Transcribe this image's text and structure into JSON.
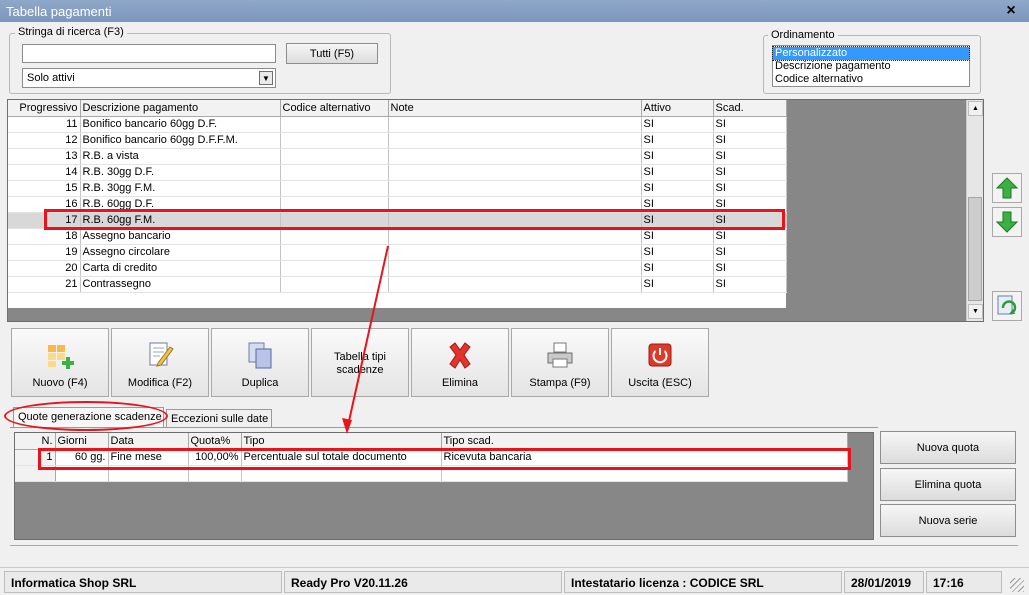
{
  "window": {
    "title": "Tabella pagamenti",
    "close_label": "×"
  },
  "search": {
    "legend": "Stringa di ricerca (F3)",
    "value": "",
    "all_button": "Tutti (F5)",
    "filter_value": "Solo attivi"
  },
  "ordering": {
    "legend": "Ordinamento",
    "options": [
      "Personalizzato",
      "Descrizione pagamento",
      "Codice alternativo"
    ],
    "selected_index": 0
  },
  "main_grid": {
    "columns": [
      "Progressivo",
      "Descrizione pagamento",
      "Codice alternativo",
      "Note",
      "Attivo",
      "Scad."
    ],
    "rows": [
      {
        "prog": "11",
        "desc": "Bonifico bancario 60gg D.F.",
        "alt": "",
        "note": "",
        "attivo": "SI",
        "scad": "SI"
      },
      {
        "prog": "12",
        "desc": "Bonifico bancario 60gg D.F.F.M.",
        "alt": "",
        "note": "",
        "attivo": "SI",
        "scad": "SI"
      },
      {
        "prog": "13",
        "desc": "R.B. a vista",
        "alt": "",
        "note": "",
        "attivo": "SI",
        "scad": "SI"
      },
      {
        "prog": "14",
        "desc": "R.B. 30gg D.F.",
        "alt": "",
        "note": "",
        "attivo": "SI",
        "scad": "SI"
      },
      {
        "prog": "15",
        "desc": "R.B. 30gg F.M.",
        "alt": "",
        "note": "",
        "attivo": "SI",
        "scad": "SI"
      },
      {
        "prog": "16",
        "desc": "R.B. 60gg D.F.",
        "alt": "",
        "note": "",
        "attivo": "SI",
        "scad": "SI"
      },
      {
        "prog": "17",
        "desc": "R.B. 60gg F.M.",
        "alt": "",
        "note": "",
        "attivo": "SI",
        "scad": "SI"
      },
      {
        "prog": "18",
        "desc": "Assegno bancario",
        "alt": "",
        "note": "",
        "attivo": "SI",
        "scad": "SI"
      },
      {
        "prog": "19",
        "desc": "Assegno circolare",
        "alt": "",
        "note": "",
        "attivo": "SI",
        "scad": "SI"
      },
      {
        "prog": "20",
        "desc": "Carta di credito",
        "alt": "",
        "note": "",
        "attivo": "SI",
        "scad": "SI"
      },
      {
        "prog": "21",
        "desc": "Contrassegno",
        "alt": "",
        "note": "",
        "attivo": "SI",
        "scad": "SI"
      }
    ],
    "selected_prog": "17"
  },
  "toolbar": {
    "new_label": "Nuovo (F4)",
    "edit_label": "Modifica (F2)",
    "duplicate_label": "Duplica",
    "types_label": "Tabella tipi scadenze",
    "delete_label": "Elimina",
    "print_label": "Stampa (F9)",
    "exit_label": "Uscita (ESC)"
  },
  "side_buttons": {
    "up_icon": "arrow-up-icon",
    "down_icon": "arrow-down-icon",
    "refresh_icon": "refresh-icon"
  },
  "tabs": [
    {
      "label": "Quote generazione scadenze",
      "active": true
    },
    {
      "label": "Eccezioni sulle date",
      "active": false
    }
  ],
  "quote_grid": {
    "columns": [
      "N.",
      "Giorni",
      "Data",
      "Quota%",
      "Tipo",
      "Tipo scad."
    ],
    "rows": [
      {
        "n": "1",
        "giorni": "60 gg.",
        "data": "Fine mese",
        "quota": "100,00%",
        "tipo": "Percentuale sul totale documento",
        "tipo_scad": "Ricevuta bancaria"
      }
    ]
  },
  "quote_buttons": {
    "new_quote": "Nuova quota",
    "delete_quote": "Elimina quota",
    "new_series": "Nuova serie"
  },
  "status": {
    "company": "Informatica Shop SRL",
    "version": "Ready Pro V20.11.26",
    "license": "Intestatario licenza : CODICE SRL",
    "date": "28/01/2019",
    "time": "17:16"
  },
  "colors": {
    "title_bar": "#7c97bd",
    "annotation": "#e8141b",
    "selection": "#3399ff"
  }
}
